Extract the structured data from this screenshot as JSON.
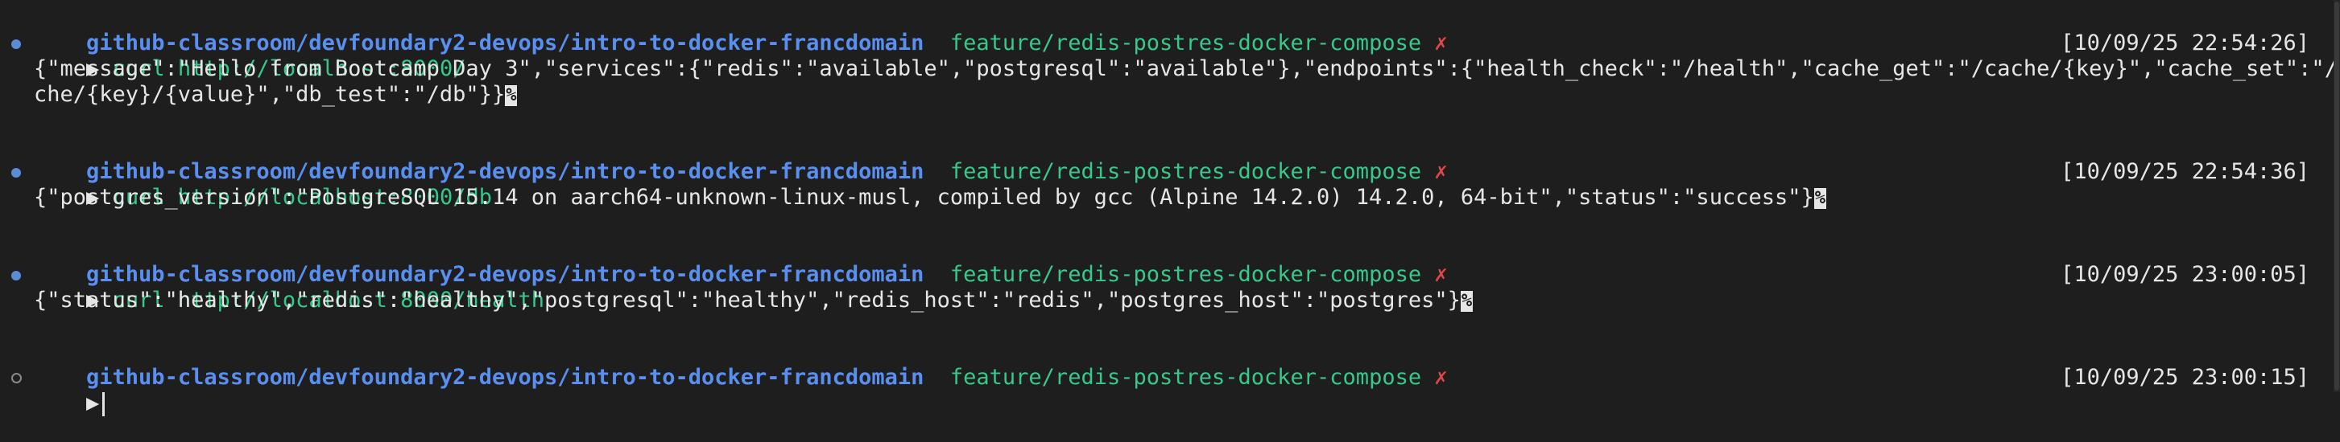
{
  "blocks": [
    {
      "dir": "github-classroom/devfoundary2-devops/intro-to-docker-francdomain",
      "branch": "feature/redis-postres-docker-compose",
      "dirty": "✗",
      "arrow": "▶",
      "command": "curl http://localhost:8000/",
      "timestamp": "[10/09/25 22:54:26]",
      "output": [
        "{\"message\":\"Hello from Bootcamp Day 3\",\"services\":{\"redis\":\"available\",\"postgresql\":\"available\"},\"endpoints\":{\"health_check\":\"/health\",\"cache_get\":\"/cache/{key}\",\"cache_set\":\"/ca",
        "che/{key}/{value}\",\"db_test\":\"/db\"}}"
      ],
      "eol_mark": "%"
    },
    {
      "dir": "github-classroom/devfoundary2-devops/intro-to-docker-francdomain",
      "branch": "feature/redis-postres-docker-compose",
      "dirty": "✗",
      "arrow": "▶",
      "command": "curl http://localhost:8000/db",
      "timestamp": "[10/09/25 22:54:36]",
      "output": [
        "{\"postgres_version\":\"PostgreSQL 15.14 on aarch64-unknown-linux-musl, compiled by gcc (Alpine 14.2.0) 14.2.0, 64-bit\",\"status\":\"success\"}"
      ],
      "eol_mark": "%"
    },
    {
      "dir": "github-classroom/devfoundary2-devops/intro-to-docker-francdomain",
      "branch": "feature/redis-postres-docker-compose",
      "dirty": "✗",
      "arrow": "▶",
      "command": "curl http://localhost:8000/health",
      "timestamp": "[10/09/25 23:00:05]",
      "output": [
        "{\"status\":\"healthy\",\"redis\":\"healthy\",\"postgresql\":\"healthy\",\"redis_host\":\"redis\",\"postgres_host\":\"postgres\"}"
      ],
      "eol_mark": "%"
    }
  ],
  "current": {
    "dir": "github-classroom/devfoundary2-devops/intro-to-docker-francdomain",
    "branch": "feature/redis-postres-docker-compose",
    "dirty": "✗",
    "arrow": "▶",
    "timestamp": "[10/09/25 23:00:15]"
  },
  "colors": {
    "background": "#1e1e1e",
    "directory": "#5a8ff0",
    "branch": "#37c98b",
    "dirty_mark": "#e04848",
    "command": "#37c98b",
    "text": "#e6e6e6",
    "marker": "#5b8dd6"
  }
}
